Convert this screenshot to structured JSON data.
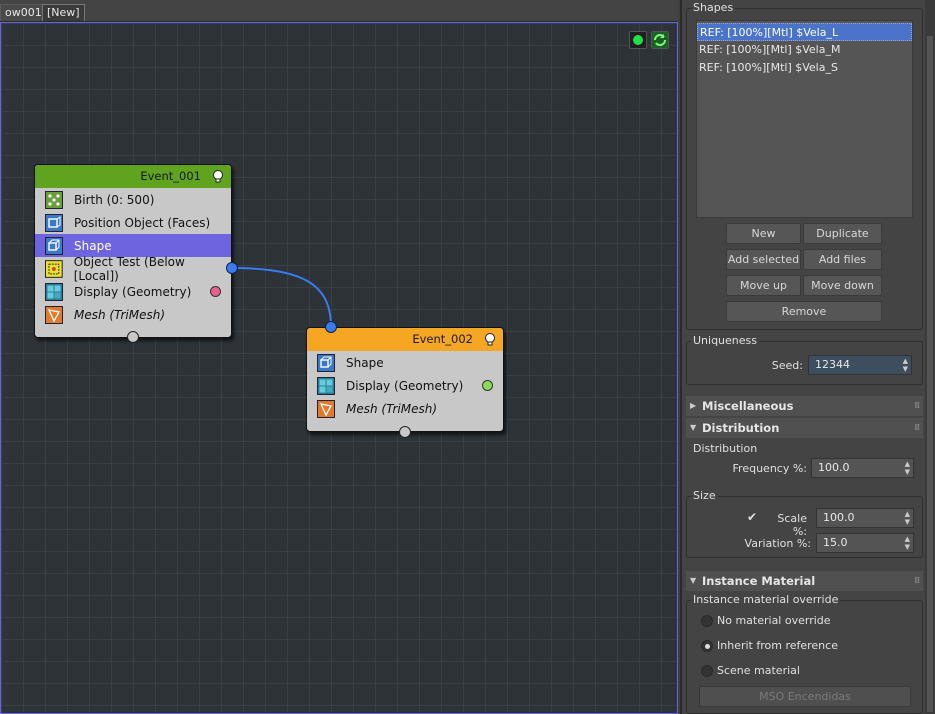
{
  "tabs": [
    {
      "label": "ow001"
    },
    {
      "label": "[New]"
    }
  ],
  "graph": {
    "tools": [
      {
        "icon": "green-dot-icon"
      },
      {
        "icon": "refresh-icon"
      }
    ],
    "events": [
      {
        "title": "Event_001",
        "header_color": "#5fa31f",
        "operators": [
          {
            "label": "Birth (0: 500)",
            "icon": "birth-icon"
          },
          {
            "label": "Position Object (Faces)",
            "icon": "position-object-icon"
          },
          {
            "label": "Shape",
            "icon": "shape-icon",
            "selected": true
          },
          {
            "label": "Object Test (Below [Local])",
            "icon": "object-test-icon"
          },
          {
            "label": "Display (Geometry)",
            "icon": "display-icon",
            "dot_color": "#e8608c"
          },
          {
            "label": "Mesh (TriMesh)",
            "icon": "mesh-icon",
            "italic": true
          }
        ]
      },
      {
        "title": "Event_002",
        "header_color": "#f5a623",
        "operators": [
          {
            "label": "Shape",
            "icon": "shape-icon"
          },
          {
            "label": "Display (Geometry)",
            "icon": "display-icon",
            "dot_color": "#88dd55"
          },
          {
            "label": "Mesh (TriMesh)",
            "icon": "mesh-icon",
            "italic": true
          }
        ]
      }
    ]
  },
  "panel": {
    "shapes": {
      "title": "Shapes",
      "items": [
        {
          "label": "REF: [100%][Mtl] $Vela_L",
          "selected": true
        },
        {
          "label": "REF: [100%][Mtl] $Vela_M"
        },
        {
          "label": "REF: [100%][Mtl] $Vela_S"
        }
      ],
      "buttons": {
        "new": "New",
        "duplicate": "Duplicate",
        "add_selected": "Add selected",
        "add_files": "Add files",
        "move_up": "Move up",
        "move_down": "Move down",
        "remove": "Remove"
      }
    },
    "uniqueness": {
      "title": "Uniqueness",
      "seed_label": "Seed:",
      "seed_value": "12344"
    },
    "rollouts": {
      "misc": "Miscellaneous",
      "distribution": "Distribution",
      "instance_material": "Instance Material"
    },
    "distribution": {
      "group_title": "Distribution",
      "frequency_label": "Frequency %:",
      "frequency_value": "100.0"
    },
    "size": {
      "group_title": "Size",
      "scale_label": "Scale %:",
      "scale_value": "100.0",
      "scale_checked": true,
      "variation_label": "Variation %:",
      "variation_value": "15.0"
    },
    "instance_material": {
      "group_title": "Instance material override",
      "options": [
        {
          "label": "No material override",
          "selected": false
        },
        {
          "label": "Inherit from reference",
          "selected": true
        },
        {
          "label": "Scene material",
          "selected": false
        }
      ],
      "mso_button": "MSO Encendidas"
    }
  }
}
